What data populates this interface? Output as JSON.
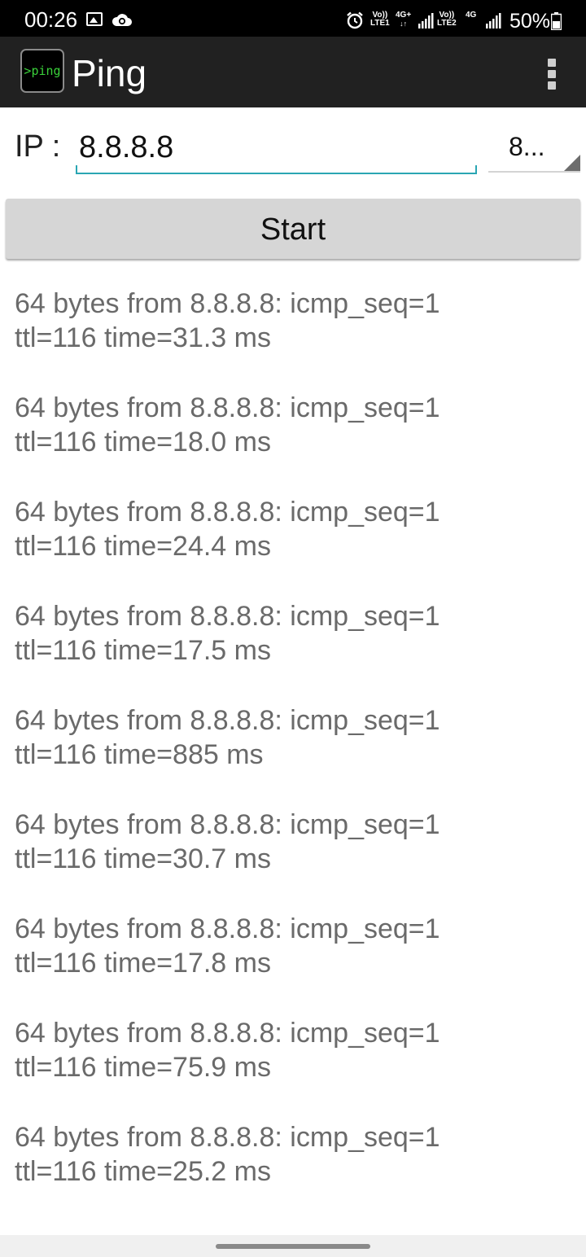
{
  "status_bar": {
    "time": "00:26",
    "sim1_top": "Vo))",
    "sim1_bottom": "LTE1",
    "sim1_net": "4G+",
    "sim2_top": "Vo))",
    "sim2_bottom": "LTE2",
    "sim2_net": "4G",
    "battery": "50%",
    "icons": [
      "image-icon",
      "cloud-sync-icon",
      "alarm-icon",
      "signal-icon",
      "battery-icon"
    ]
  },
  "action_bar": {
    "logo_text": ">ping",
    "title": "Ping"
  },
  "form": {
    "ip_label": "IP :",
    "ip_value": "8.8.8.8",
    "count_value": "8..."
  },
  "start_label": "Start",
  "results": [
    "64 bytes from 8.8.8.8: icmp_seq=1\nttl=116 time=31.3 ms",
    "64 bytes from 8.8.8.8: icmp_seq=1\nttl=116 time=18.0 ms",
    "64 bytes from 8.8.8.8: icmp_seq=1\nttl=116 time=24.4 ms",
    "64 bytes from 8.8.8.8: icmp_seq=1\nttl=116 time=17.5 ms",
    "64 bytes from 8.8.8.8: icmp_seq=1\nttl=116 time=885 ms",
    "64 bytes from 8.8.8.8: icmp_seq=1\nttl=116 time=30.7 ms",
    "64 bytes from 8.8.8.8: icmp_seq=1\nttl=116 time=17.8 ms",
    "64 bytes from 8.8.8.8: icmp_seq=1\nttl=116 time=75.9 ms",
    "64 bytes from 8.8.8.8: icmp_seq=1\nttl=116 time=25.2 ms"
  ],
  "colors": {
    "action_bar": "#212121",
    "accent_underline": "#2aa6b3",
    "logo_text": "#3ad13a",
    "button_bg": "#d6d6d6",
    "result_text": "#6a6a6a"
  }
}
